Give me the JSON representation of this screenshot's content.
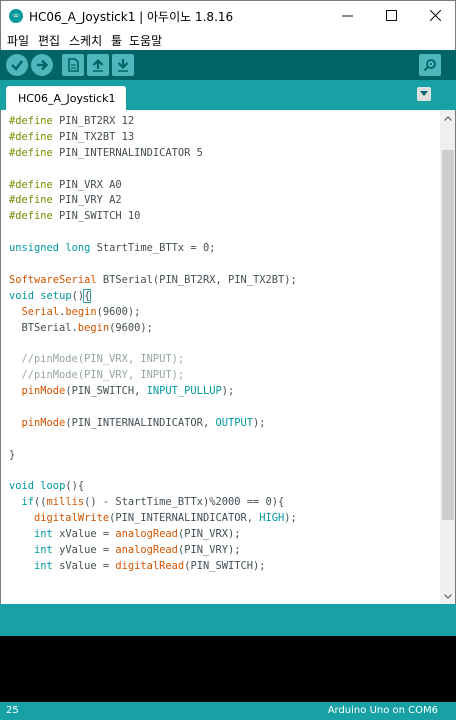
{
  "window": {
    "title": "HC06_A_Joystick1 | 아두이노 1.8.16",
    "app_icon_text": "∞"
  },
  "menu": {
    "items": [
      "파일",
      "편집",
      "스케치",
      "툴",
      "도움말"
    ]
  },
  "toolbar": {
    "buttons": [
      "verify",
      "upload",
      "new",
      "open",
      "save",
      "serial-monitor"
    ]
  },
  "tabs": {
    "active": "HC06_A_Joystick1"
  },
  "editor": {
    "lines": [
      [
        {
          "t": "#define",
          "c": "k-pre"
        },
        {
          "t": " PIN_BT2RX 12",
          "c": "k-plain"
        }
      ],
      [
        {
          "t": "#define",
          "c": "k-pre"
        },
        {
          "t": " PIN_TX2BT 13",
          "c": "k-plain"
        }
      ],
      [
        {
          "t": "#define",
          "c": "k-pre"
        },
        {
          "t": " PIN_INTERNALINDICATOR 5",
          "c": "k-plain"
        }
      ],
      [],
      [
        {
          "t": "#define",
          "c": "k-pre"
        },
        {
          "t": " PIN_VRX A0",
          "c": "k-plain"
        }
      ],
      [
        {
          "t": "#define",
          "c": "k-pre"
        },
        {
          "t": " PIN_VRY A2",
          "c": "k-plain"
        }
      ],
      [
        {
          "t": "#define",
          "c": "k-pre"
        },
        {
          "t": " PIN_SWITCH 10",
          "c": "k-plain"
        }
      ],
      [],
      [
        {
          "t": "unsigned",
          "c": "k-type"
        },
        {
          "t": " ",
          "c": "k-plain"
        },
        {
          "t": "long",
          "c": "k-type"
        },
        {
          "t": " StartTime_BTTx = 0;",
          "c": "k-plain"
        }
      ],
      [],
      [
        {
          "t": "SoftwareSerial",
          "c": "k-class"
        },
        {
          "t": " BTSerial(PIN_BT2RX, PIN_TX2BT);",
          "c": "k-plain"
        }
      ],
      [
        {
          "t": "void",
          "c": "k-type"
        },
        {
          "t": " ",
          "c": "k-plain"
        },
        {
          "t": "setup",
          "c": "k-type"
        },
        {
          "t": "()",
          "c": "k-plain"
        },
        {
          "t": "{",
          "c": "k-bracket"
        }
      ],
      [
        {
          "t": "  ",
          "c": "k-plain"
        },
        {
          "t": "Serial",
          "c": "k-class"
        },
        {
          "t": ".",
          "c": "k-plain"
        },
        {
          "t": "begin",
          "c": "k-func"
        },
        {
          "t": "(9600);",
          "c": "k-plain"
        }
      ],
      [
        {
          "t": "  BTSerial.",
          "c": "k-plain"
        },
        {
          "t": "begin",
          "c": "k-func"
        },
        {
          "t": "(9600);",
          "c": "k-plain"
        }
      ],
      [],
      [
        {
          "t": "  //pinMode(PIN_VRX, INPUT);",
          "c": "k-comment"
        }
      ],
      [
        {
          "t": "  //pinMode(PIN_VRY, INPUT);",
          "c": "k-comment"
        }
      ],
      [
        {
          "t": "  ",
          "c": "k-plain"
        },
        {
          "t": "pinMode",
          "c": "k-func"
        },
        {
          "t": "(PIN_SWITCH, ",
          "c": "k-plain"
        },
        {
          "t": "INPUT_PULLUP",
          "c": "k-const"
        },
        {
          "t": ");",
          "c": "k-plain"
        }
      ],
      [],
      [
        {
          "t": "  ",
          "c": "k-plain"
        },
        {
          "t": "pinMode",
          "c": "k-func"
        },
        {
          "t": "(PIN_INTERNALINDICATOR, ",
          "c": "k-plain"
        },
        {
          "t": "OUTPUT",
          "c": "k-const"
        },
        {
          "t": ");",
          "c": "k-plain"
        }
      ],
      [],
      [
        {
          "t": "}",
          "c": "k-plain"
        }
      ],
      [],
      [
        {
          "t": "void",
          "c": "k-type"
        },
        {
          "t": " ",
          "c": "k-plain"
        },
        {
          "t": "loop",
          "c": "k-type"
        },
        {
          "t": "(){",
          "c": "k-plain"
        }
      ],
      [
        {
          "t": "  ",
          "c": "k-plain"
        },
        {
          "t": "if",
          "c": "k-type"
        },
        {
          "t": "((",
          "c": "k-plain"
        },
        {
          "t": "millis",
          "c": "k-func"
        },
        {
          "t": "() - StartTime_BTTx)%2000 == 0){",
          "c": "k-plain"
        }
      ],
      [
        {
          "t": "    ",
          "c": "k-plain"
        },
        {
          "t": "digitalWrite",
          "c": "k-func"
        },
        {
          "t": "(PIN_INTERNALINDICATOR, ",
          "c": "k-plain"
        },
        {
          "t": "HIGH",
          "c": "k-const"
        },
        {
          "t": ");",
          "c": "k-plain"
        }
      ],
      [
        {
          "t": "    ",
          "c": "k-plain"
        },
        {
          "t": "int",
          "c": "k-type"
        },
        {
          "t": " xValue = ",
          "c": "k-plain"
        },
        {
          "t": "analogRead",
          "c": "k-func"
        },
        {
          "t": "(PIN_VRX);",
          "c": "k-plain"
        }
      ],
      [
        {
          "t": "    ",
          "c": "k-plain"
        },
        {
          "t": "int",
          "c": "k-type"
        },
        {
          "t": " yValue = ",
          "c": "k-plain"
        },
        {
          "t": "analogRead",
          "c": "k-func"
        },
        {
          "t": "(PIN_VRY);",
          "c": "k-plain"
        }
      ],
      [
        {
          "t": "    ",
          "c": "k-plain"
        },
        {
          "t": "int",
          "c": "k-type"
        },
        {
          "t": " sValue = ",
          "c": "k-plain"
        },
        {
          "t": "digitalRead",
          "c": "k-func"
        },
        {
          "t": "(PIN_SWITCH);",
          "c": "k-plain"
        }
      ]
    ]
  },
  "status": {
    "line": "25",
    "board": "Arduino Uno on COM6"
  },
  "colors": {
    "toolbar": "#006468",
    "teal": "#17a1a5",
    "button": "#4db7bb",
    "console": "#000000"
  }
}
